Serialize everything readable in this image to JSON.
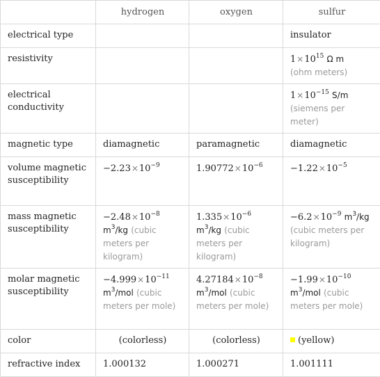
{
  "columns": [
    "",
    "hydrogen",
    "oxygen",
    "sulfur"
  ],
  "rows": {
    "electrical_type": {
      "label": "electrical type",
      "sulfur": "insulator"
    },
    "resistivity": {
      "label": "resistivity",
      "sulfur": {
        "mantissa": "1",
        "times": "×",
        "base": "10",
        "exp": "15",
        "unit": "Ω m",
        "note": "(ohm meters)"
      }
    },
    "electrical_conductivity": {
      "label": "electrical conductivity",
      "sulfur": {
        "mantissa": "1",
        "times": "×",
        "base": "10",
        "exp": "−15",
        "unit": "S/m",
        "note": "(siemens per meter)"
      }
    },
    "magnetic_type": {
      "label": "magnetic type",
      "hydrogen": "diamagnetic",
      "oxygen": "paramagnetic",
      "sulfur": "diamagnetic"
    },
    "volume_magnetic_susceptibility": {
      "label": "volume magnetic susceptibility",
      "hydrogen": {
        "mantissa": "−2.23",
        "times": "×",
        "base": "10",
        "exp": "−9"
      },
      "oxygen": {
        "mantissa": "1.90772",
        "times": "×",
        "base": "10",
        "exp": "−6"
      },
      "sulfur": {
        "mantissa": "−1.22",
        "times": "×",
        "base": "10",
        "exp": "−5"
      }
    },
    "mass_magnetic_susceptibility": {
      "label": "mass magnetic susceptibility",
      "hydrogen": {
        "mantissa": "−2.48",
        "times": "×",
        "base": "10",
        "exp": "−8",
        "unit_pre": "m",
        "unit_exp": "3",
        "unit_post": "/kg",
        "note": "(cubic meters per kilogram)"
      },
      "oxygen": {
        "mantissa": "1.335",
        "times": "×",
        "base": "10",
        "exp": "−6",
        "unit_pre": "m",
        "unit_exp": "3",
        "unit_post": "/kg",
        "note": "(cubic meters per kilogram)"
      },
      "sulfur": {
        "mantissa": "−6.2",
        "times": "×",
        "base": "10",
        "exp": "−9",
        "unit_pre": "m",
        "unit_exp": "3",
        "unit_post": "/kg",
        "note": "(cubic meters per kilogram)"
      }
    },
    "molar_magnetic_susceptibility": {
      "label": "molar magnetic susceptibility",
      "hydrogen": {
        "mantissa": "−4.999",
        "times": "×",
        "base": "10",
        "exp": "−11",
        "unit_pre": "m",
        "unit_exp": "3",
        "unit_post": "/mol",
        "note": "(cubic meters per mole)"
      },
      "oxygen": {
        "mantissa": "4.27184",
        "times": "×",
        "base": "10",
        "exp": "−8",
        "unit_pre": "m",
        "unit_exp": "3",
        "unit_post": "/mol",
        "note": "(cubic meters per mole)"
      },
      "sulfur": {
        "mantissa": "−1.99",
        "times": "×",
        "base": "10",
        "exp": "−10",
        "unit_pre": "m",
        "unit_exp": "3",
        "unit_post": "/mol",
        "note": "(cubic meters per mole)"
      }
    },
    "color": {
      "label": "color",
      "hydrogen": "(colorless)",
      "oxygen": "(colorless)",
      "sulfur": "(yellow)",
      "sulfur_swatch": "#ffff00"
    },
    "refractive_index": {
      "label": "refractive index",
      "hydrogen": "1.000132",
      "oxygen": "1.000271",
      "sulfur": "1.001111"
    }
  },
  "colors": {
    "border": "#d9d9d9",
    "label_text": "#555555",
    "value_text": "#222222",
    "note_text": "#999999",
    "yellow_swatch": "#ffff00"
  }
}
